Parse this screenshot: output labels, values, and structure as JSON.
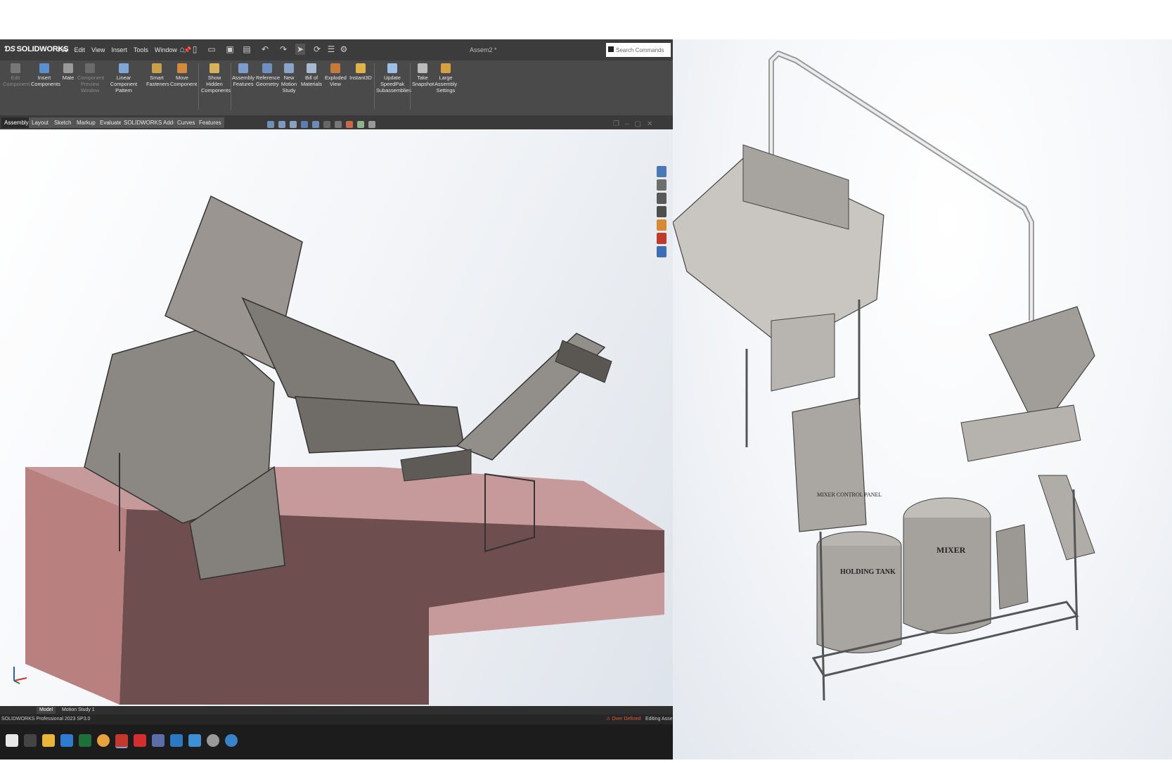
{
  "app": {
    "name": "SOLIDWORKS",
    "title": "Assem2 *",
    "menu": [
      "File",
      "Edit",
      "View",
      "Insert",
      "Tools",
      "Window"
    ],
    "search_placeholder": "Search Commands"
  },
  "ribbon": {
    "commands": [
      {
        "label": "Edit Component",
        "enabled": false
      },
      {
        "label": "Insert Components",
        "enabled": true
      },
      {
        "label": "Mate",
        "enabled": true
      },
      {
        "label": "Component Preview Window",
        "enabled": false
      },
      {
        "label": "Linear Component Pattern",
        "enabled": true
      },
      {
        "label": "Smart Fasteners",
        "enabled": true
      },
      {
        "label": "Move Component",
        "enabled": true
      },
      {
        "label": "Show Hidden Components",
        "enabled": true
      },
      {
        "label": "Assembly Features",
        "enabled": true
      },
      {
        "label": "Reference Geometry",
        "enabled": true
      },
      {
        "label": "New Motion Study",
        "enabled": true
      },
      {
        "label": "Bill of Materials",
        "enabled": true
      },
      {
        "label": "Exploded View",
        "enabled": true
      },
      {
        "label": "Instant3D",
        "enabled": true
      },
      {
        "label": "Update SpeedPak Subassemblies",
        "enabled": true
      },
      {
        "label": "Take Snapshot",
        "enabled": true
      },
      {
        "label": "Large Assembly Settings",
        "enabled": true
      }
    ]
  },
  "tabs": [
    "Assembly",
    "Layout",
    "Sketch",
    "Markup",
    "Evaluate",
    "SOLIDWORKS Add-Ins",
    "Curves",
    "Features"
  ],
  "active_tab": "Assembly",
  "bottom_tabs": [
    "Model",
    "Motion Study 1"
  ],
  "active_bottom_tab": "Model",
  "status": {
    "version": "SOLIDWORKS Professional 2023 SP3.0",
    "warning": "Over Defined",
    "mode": "Editing Asse"
  },
  "overlay_labels": {
    "mixer": "MIXER",
    "holding_tank": "HOLDING TANK",
    "controller": "MIXER CONTROL PANEL"
  },
  "colors": {
    "accent": "#d32f2f",
    "machine": "#8f8b86",
    "base_block": "#c48a8a"
  }
}
